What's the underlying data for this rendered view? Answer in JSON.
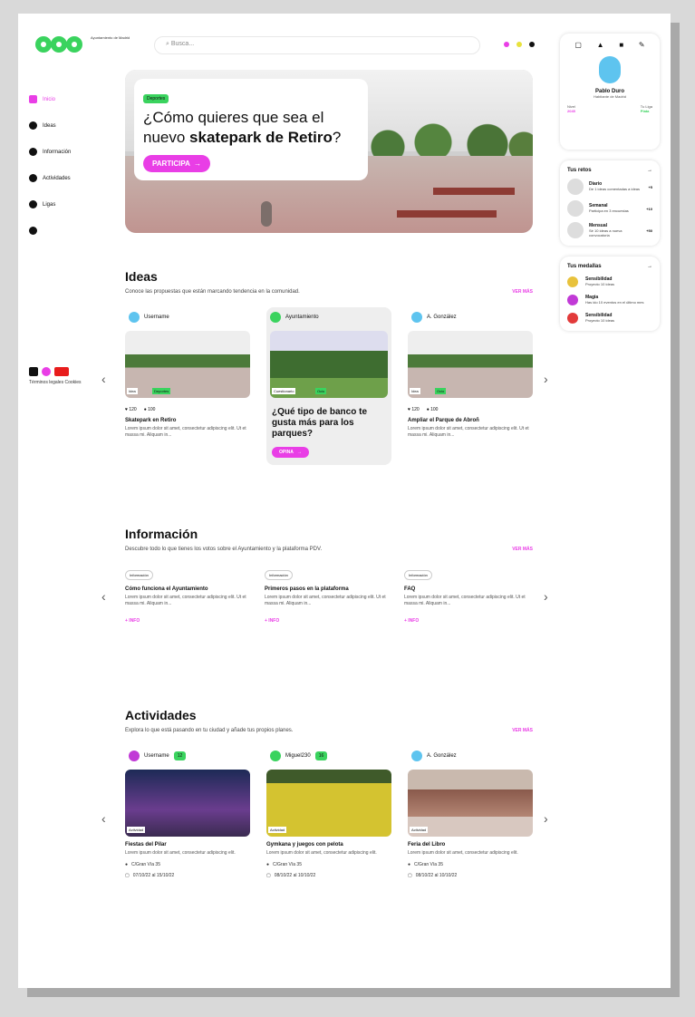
{
  "header": {
    "logo_text": "PDV",
    "logo_subtitle": "Ayuntamiento de Madrid",
    "search_placeholder": "Busca..."
  },
  "colors": {
    "accent_pink": "#e93ee6",
    "accent_green": "#3ad35e",
    "accent_yellow": "#e8e23c"
  },
  "sidebar": {
    "items": [
      {
        "label": "Inicio",
        "icon": "home-icon"
      },
      {
        "label": "Ideas",
        "icon": "pin-icon"
      },
      {
        "label": "Información",
        "icon": "info-icon"
      },
      {
        "label": "Actividades",
        "icon": "location-icon"
      },
      {
        "label": "Ligas",
        "icon": "shield-icon"
      },
      {
        "label": "",
        "icon": "help-icon"
      }
    ],
    "social_text": "Términos legales Cookies"
  },
  "hero": {
    "tag": "Deportes",
    "title_pre": "¿Cómo quieres que sea el nuevo ",
    "title_bold": "skatepark de Retiro",
    "title_post": "?",
    "button": "PARTICIPA"
  },
  "profile": {
    "name": "Pablo Duro",
    "subtitle": "Habitante de Madrid",
    "stat1_label": "Nivel",
    "stat1_value": "2045",
    "stat2_label": "Tu Liga",
    "stat2_value": "Plata"
  },
  "ranking": {
    "title": "Tus retos",
    "items": [
      {
        "name": "Diario",
        "desc": "De 1 ideas comentadas a ideas",
        "score": "+5"
      },
      {
        "name": "Semanal",
        "desc": "Participa en 3 encuestas",
        "score": "+10"
      },
      {
        "name": "Mensual",
        "desc": "Sé 10 ideas a nueva convocatoria",
        "score": "+50"
      }
    ]
  },
  "medals": {
    "title": "Tus medallas",
    "items": [
      {
        "name": "Sensibilidad",
        "desc": "Proyecto 10 ideas"
      },
      {
        "name": "Magia",
        "desc": "Has ido 10 eventos en el último mes"
      },
      {
        "name": "Sensibilidad",
        "desc": "Proyecto 10 ideas"
      }
    ]
  },
  "ideas": {
    "title": "Ideas",
    "desc": "Conoce las propuestas que están marcando tendencia en la comunidad.",
    "more": "VER MÁS",
    "cards": [
      {
        "user": "Username",
        "label": "Idea",
        "tag": "Deportes",
        "likes": "120",
        "comments": "100",
        "title": "Skatepark en Retiro",
        "body": "Lorem ipsum dolor sit amet, consectetur adipiscing elit. Ut et massa mi. Aliquam in..."
      },
      {
        "user": "Ayuntamiento",
        "label": "Cuestionario",
        "tag": "Ocio",
        "question": "¿Qué tipo de banco te gusta más para los parques?",
        "button": "OPINA"
      },
      {
        "user": "A. González",
        "label": "Idea",
        "tag": "Ocio",
        "likes": "120",
        "comments": "100",
        "title": "Ampliar el Parque de Abroñ",
        "body": "Lorem ipsum dolor sit amet, consectetur adipiscing elit. Ut et massa mi. Aliquam in..."
      }
    ]
  },
  "info": {
    "title": "Información",
    "desc": "Descubre todo lo que tienes los votos sobre el Ayuntamiento y la plataforma PDV.",
    "more": "VER MÁS",
    "cards": [
      {
        "tag": "Información",
        "title": "Cómo funciona el Ayuntamiento",
        "body": "Lorem ipsum dolor sit amet, consectetur adipiscing elit. Ut et massa mi. Aliquam in...",
        "more": "+ INFO"
      },
      {
        "tag": "Información",
        "title": "Primeros pasos en la plataforma",
        "body": "Lorem ipsum dolor sit amet, consectetur adipiscing elit. Ut et massa mi. Aliquam in...",
        "more": "+ INFO"
      },
      {
        "tag": "Información",
        "title": "FAQ",
        "body": "Lorem ipsum dolor sit amet, consectetur adipiscing elit. Ut et massa mi. Aliquam in...",
        "more": "+ INFO"
      }
    ]
  },
  "activities": {
    "title": "Actividades",
    "desc": "Explora lo que está pasando en tu ciudad y añade tus propios planes.",
    "more": "VER MÁS",
    "cards": [
      {
        "user": "Username",
        "badge": "12",
        "label": "Actividad",
        "title": "Fiestas del Pilar",
        "body": "Lorem ipsum dolor sit amet, consectetur adipiscing elit.",
        "place": "C/Gran Vía 35",
        "date": "07/10/22 al 15/10/22"
      },
      {
        "user": "Miguel230",
        "badge": "16",
        "label": "Actividad",
        "title": "Gymkana y juegos con pelota",
        "body": "Lorem ipsum dolor sit amet, consectetur adipiscing elit.",
        "place": "C/Gran Vía 35",
        "date": "08/10/22 al 10/10/22"
      },
      {
        "user": "A. González",
        "badge": "",
        "label": "Actividad",
        "title": "Feria del Libro",
        "body": "Lorem ipsum dolor sit amet, consectetur adipiscing elit.",
        "place": "C/Gran Vía 35",
        "date": "08/10/22 al 10/10/22"
      }
    ]
  }
}
